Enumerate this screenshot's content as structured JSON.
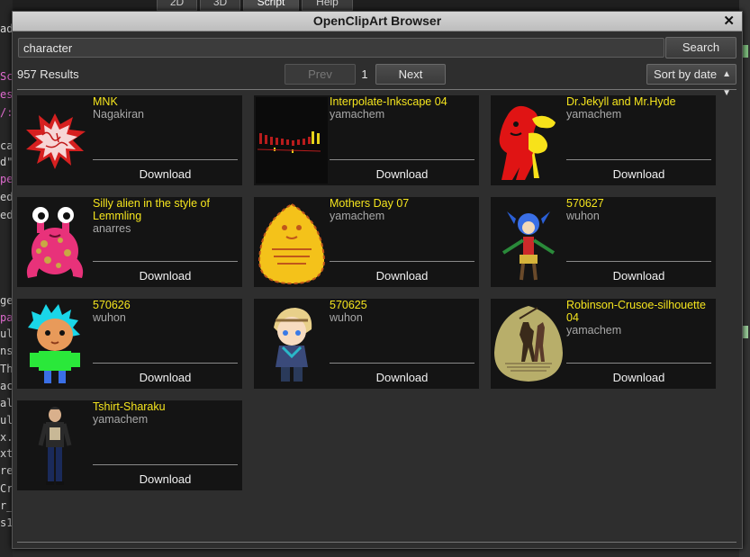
{
  "background": {
    "tabs": [
      "2D",
      "3D",
      "Script",
      "Help"
    ],
    "code_fragments": [
      "add",
      "Sc",
      "es",
      "/:",
      "ca",
      "d\"",
      "per",
      "ed",
      "ed",
      "ge",
      "pad",
      "ul",
      "ns",
      "Th",
      "ac",
      "al",
      "ul",
      "x.",
      "xt",
      "res",
      "Cre",
      "r_",
      "s1",
      "r_"
    ]
  },
  "dialog": {
    "title": "OpenClipArt Browser",
    "close_label": "✕"
  },
  "search": {
    "value": "character",
    "button_label": "Search"
  },
  "pagination": {
    "results_label": "957 Results",
    "prev_label": "Prev",
    "page": "1",
    "next_label": "Next"
  },
  "sort": {
    "selected": "Sort by date"
  },
  "download_label": "Download",
  "items": [
    {
      "title": "MNK",
      "author": "Nagakiran",
      "thumb": "mnk-star"
    },
    {
      "title": "Interpolate-Inkscape 04",
      "author": "yamachem",
      "thumb": "interpolate-figures"
    },
    {
      "title": "Dr.Jekyll and Mr.Hyde",
      "author": "yamachem",
      "thumb": "jekyll-hyde"
    },
    {
      "title": "Silly alien in the style of Lemmling",
      "author": "anarres",
      "thumb": "pink-alien"
    },
    {
      "title": "Mothers Day 07",
      "author": "yamachem",
      "thumb": "mothers-day-egg"
    },
    {
      "title": "570627",
      "author": "wuhon",
      "thumb": "jester-figure"
    },
    {
      "title": "570626",
      "author": "wuhon",
      "thumb": "blue-hair-kid"
    },
    {
      "title": "570625",
      "author": "wuhon",
      "thumb": "anime-boy"
    },
    {
      "title": "Robinson-Crusoe-silhouette 04",
      "author": "yamachem",
      "thumb": "crusoe-silhouette"
    },
    {
      "title": "Tshirt-Sharaku",
      "author": "yamachem",
      "thumb": "tshirt-man"
    }
  ],
  "colors": {
    "title_yellow": "#f5e51e",
    "author_gray": "#a8a8a8",
    "card_bg": "#141414",
    "dialog_bg": "#2e2e2e"
  }
}
